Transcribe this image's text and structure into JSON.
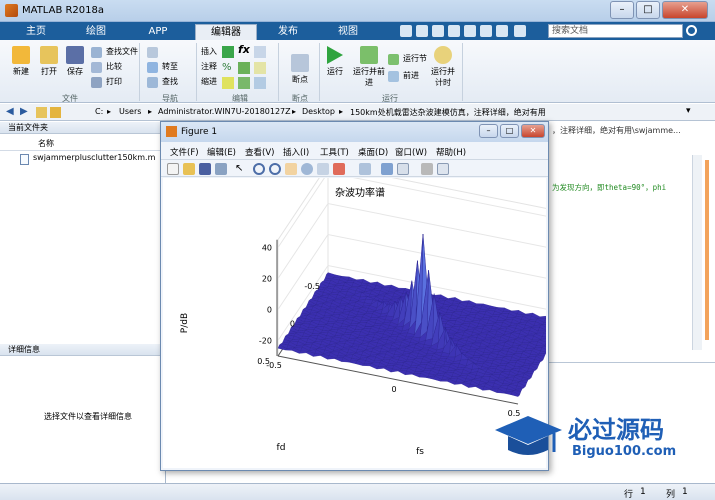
{
  "window": {
    "title": "MATLAB R2018a"
  },
  "tabs": [
    {
      "label": "主页"
    },
    {
      "label": "绘图"
    },
    {
      "label": "APP"
    },
    {
      "label": "编辑器"
    },
    {
      "label": "发布"
    },
    {
      "label": "视图"
    }
  ],
  "search": {
    "placeholder": "搜索文档"
  },
  "ribbon": {
    "file_group": {
      "label": "文件",
      "new": "新建",
      "open": "打开",
      "save": "保存",
      "find_files": "查找文件",
      "compare": "比较",
      "print": "打印"
    },
    "nav_group": {
      "label": "导航",
      "goto": "转至",
      "find": "查找"
    },
    "edit_group": {
      "label": "编辑",
      "insert": "插入",
      "comment": "注释",
      "indent": "缩进"
    },
    "breakpoint_group": {
      "label": "断点",
      "breakpoints": "断点"
    },
    "run_group": {
      "label": "运行",
      "run": "运行",
      "run_advance": "运行并前进",
      "run_section": "运行节",
      "advance": "前进",
      "run_time": "运行并计时"
    }
  },
  "address": {
    "segments": [
      "C:",
      "Users",
      "Administrator.WIN7U-20180127Z",
      "Desktop",
      "150km处机载雷达杂波建模仿真，注释详细，绝对有用"
    ]
  },
  "current_folder": {
    "header": "当前文件夹",
    "column": "名称",
    "files": [
      "swjammerplusclutter150km.m"
    ]
  },
  "details": {
    "header": "详细信息",
    "message": "选择文件以查看详细信息"
  },
  "editor_right": {
    "line1": "，注释详细，绝对有用\\swjamme...",
    "line2": "为发现方向，即theta=90°，phi"
  },
  "status": {
    "row_label": "行",
    "row": "1",
    "col_label": "列",
    "col": "1"
  },
  "figure": {
    "title": "Figure 1",
    "menu": [
      "文件(F)",
      "编辑(E)",
      "查看(V)",
      "插入(I)",
      "工具(T)",
      "桌面(D)",
      "窗口(W)",
      "帮助(H)"
    ]
  },
  "chart_data": {
    "type": "surface",
    "title": "杂波功率谱",
    "xlabel": "fs",
    "ylabel": "fd",
    "zlabel": "P/dB",
    "xlim": [
      -0.5,
      0.5
    ],
    "ylim": [
      -0.5,
      0.5
    ],
    "zlim": [
      -30,
      45
    ],
    "x_ticks": [
      -0.5,
      0,
      0.5
    ],
    "y_ticks": [
      -0.5,
      0,
      0.5
    ],
    "z_ticks": [
      -20,
      0,
      20,
      40
    ],
    "floor_level": -25,
    "ridge": {
      "description_direction": "fd = fs",
      "peak": 40,
      "peak_at": [
        0,
        0
      ]
    },
    "colors": {
      "low": "#3b2fb0",
      "high": "#ffffff",
      "mid": "#5b73e0"
    }
  },
  "watermark": {
    "text": "必过源码",
    "url": "Biguo100.com"
  }
}
